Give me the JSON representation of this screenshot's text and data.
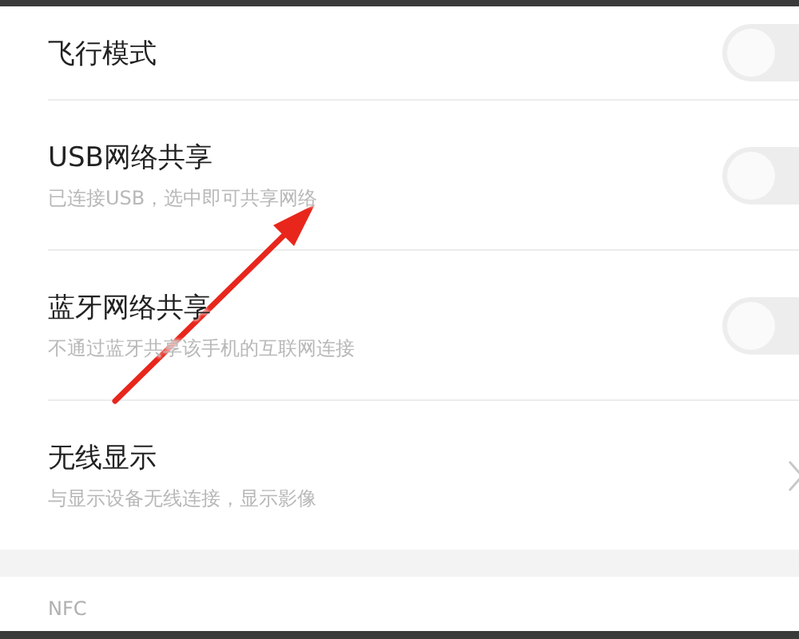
{
  "settings": [
    {
      "kind": "toggle",
      "title": "飞行模式",
      "on": false
    },
    {
      "kind": "toggle",
      "title": "USB网络共享",
      "subtitle": "已连接USB，选中即可共享网络",
      "on": false
    },
    {
      "kind": "toggle",
      "title": "蓝牙网络共享",
      "subtitle": "不通过蓝牙共享该手机的互联网连接",
      "on": false
    },
    {
      "kind": "link",
      "title": "无线显示",
      "subtitle": "与显示设备无线连接，显示影像"
    }
  ],
  "section_header": "NFC"
}
